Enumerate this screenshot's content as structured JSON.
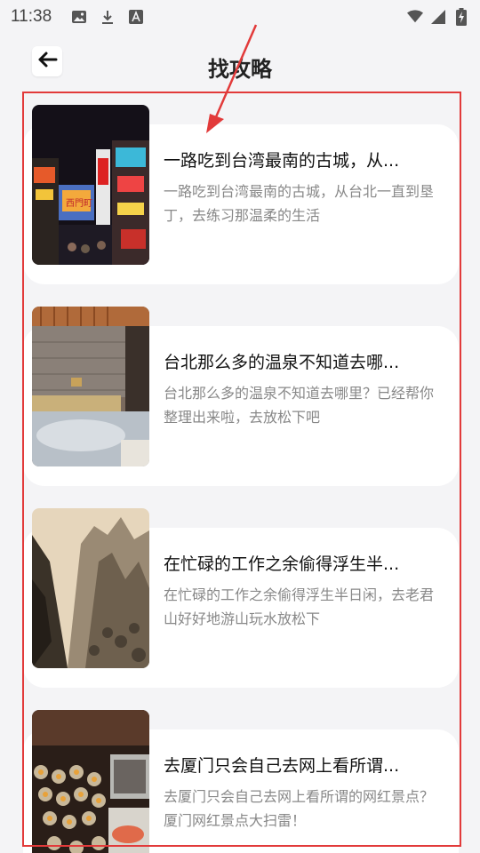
{
  "status_bar": {
    "time": "11:38",
    "left_icons": [
      "image-icon",
      "download-icon",
      "font-icon"
    ],
    "right_icons": [
      "wifi-icon",
      "signal-icon",
      "battery-charging-icon"
    ]
  },
  "header": {
    "title": "找攻略",
    "back_icon": "arrow-left-icon"
  },
  "guides": [
    {
      "title": "一路吃到台湾最南的古城，从...",
      "desc": "一路吃到台湾最南的古城，从台北一直到垦丁，去练习那温柔的生活",
      "image": "taipei-night-street"
    },
    {
      "title": "台北那么多的温泉不知道去哪...",
      "desc": "台北那么多的温泉不知道去哪里？已经帮你整理出来啦，去放松下吧",
      "image": "hot-spring-pool"
    },
    {
      "title": "在忙碌的工作之余偷得浮生半...",
      "desc": "在忙碌的工作之余偷得浮生半日闲，去老君山好好地游山玩水放松下",
      "image": "mountain-peaks"
    },
    {
      "title": "去厦门只会自己去网上看所谓...",
      "desc": "去厦门只会自己去网上看所谓的网红景点？厦门网红景点大扫雷！",
      "image": "seafood-grill"
    }
  ],
  "colors": {
    "highlight": "#e23a3a",
    "background": "#f4f4f6",
    "card": "#ffffff",
    "desc_text": "#888888"
  }
}
